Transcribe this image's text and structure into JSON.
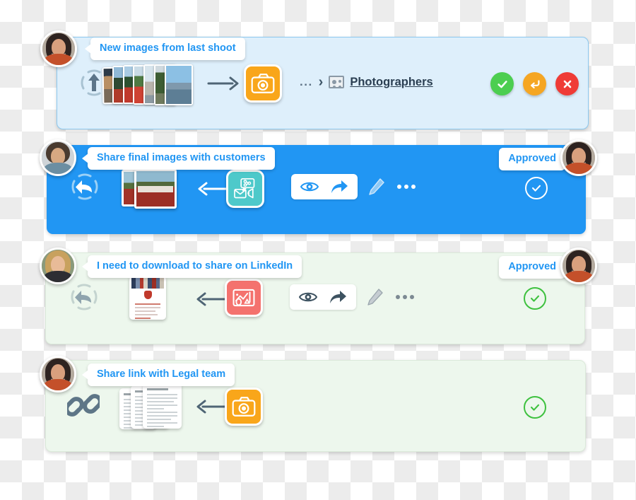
{
  "page": {
    "title": "Approval workflow cards",
    "accent_blue": "#2196f3",
    "card_blue_light_bg": "#deeffb",
    "card_blue_solid_bg": "#2196f3",
    "card_green_light_bg": "#edf7ed",
    "approve_green": "#4cce50",
    "reply_orange": "#f5a623",
    "reject_red": "#ef3b36"
  },
  "cards": [
    {
      "id": "card-1",
      "theme": "blue-light",
      "avatar_name": "avatar-requester-1",
      "callout": "New images from last shoot",
      "source_icon": "upload-icon",
      "thumbnail": "photo-stack-thumbnail",
      "flow_arrow": "arrow-right-icon",
      "app_tile": "camera-app-icon",
      "breadcrumb_dots": "...",
      "breadcrumb_chevron": "›",
      "destination_icon": "group-icon",
      "destination_label": "Photographers",
      "actions": [
        {
          "name": "approve-button",
          "icon": "check-icon",
          "color": "#4cce50"
        },
        {
          "name": "reply-button",
          "icon": "reply-arrow-icon",
          "color": "#f5a623"
        },
        {
          "name": "reject-button",
          "icon": "close-icon",
          "color": "#ef3b36"
        }
      ]
    },
    {
      "id": "card-2",
      "theme": "blue-solid",
      "avatar_name": "avatar-requester-2",
      "callout": "Share final images with customers",
      "source_icon": "reply-circle-icon",
      "thumbnail": "poppy-field-photo-thumbnail",
      "flow_arrow": "arrow-left-icon",
      "app_tile": "share-email-megaphone-app-icon",
      "toolbar": {
        "preview": "eye-icon",
        "share": "share-arrow-icon",
        "edit": "pencil-icon",
        "more": "more-options-icon"
      },
      "status_label": "Approved",
      "status_icon": "check-circle-icon",
      "approver_avatar_name": "avatar-approver-2"
    },
    {
      "id": "card-3",
      "theme": "green-light",
      "avatar_name": "avatar-requester-3",
      "callout": "I need to download to share on LinkedIn",
      "source_icon": "reply-circle-icon",
      "thumbnail": "newsletter-document-thumbnail",
      "flow_arrow": "arrow-left-icon",
      "app_tile": "chart-app-icon",
      "toolbar": {
        "preview": "eye-icon",
        "share": "share-arrow-icon",
        "edit": "pencil-icon",
        "more": "more-options-icon"
      },
      "status_label": "Approved",
      "status_icon": "check-circle-icon",
      "approver_avatar_name": "avatar-approver-3"
    },
    {
      "id": "card-4",
      "theme": "green-light",
      "avatar_name": "avatar-requester-4",
      "callout": "Share link with Legal team",
      "source_icon": "link-chain-icon",
      "thumbnail": "document-stack-thumbnail",
      "flow_arrow": "arrow-left-icon",
      "app_tile": "camera-app-icon",
      "status_icon": "check-circle-icon"
    }
  ]
}
